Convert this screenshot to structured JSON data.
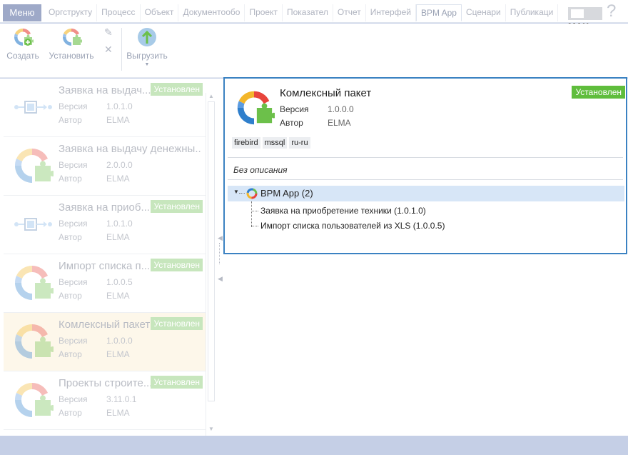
{
  "menubar": {
    "menu_label": "Меню",
    "tabs": [
      "Оргструкту",
      "Процесс",
      "Объект",
      "Документообо",
      "Проект",
      "Показател",
      "Отчет",
      "Интерфей",
      "BPM App",
      "Сценари",
      "Публикаци"
    ],
    "active_tab": "BPM App",
    "max_label": "MAX",
    "help_glyph": "?"
  },
  "toolbar": {
    "create_label": "Создать",
    "install_label": "Установить",
    "export_label": "Выгрузить"
  },
  "list": {
    "items": [
      {
        "title": "Заявка на выдач...",
        "badge": "Установлен",
        "version_label": "Версия",
        "version": "1.0.1.0",
        "author_label": "Автор",
        "author": "ELMA",
        "icon": "process-diagram-icon"
      },
      {
        "title": "Заявка на выдачу денежны...",
        "badge": "",
        "version_label": "Версия",
        "version": "2.0.0.0",
        "author_label": "Автор",
        "author": "ELMA",
        "icon": "bpm-package-icon"
      },
      {
        "title": "Заявка на приоб...",
        "badge": "Установлен",
        "version_label": "Версия",
        "version": "1.0.1.0",
        "author_label": "Автор",
        "author": "ELMA",
        "icon": "process-diagram-icon"
      },
      {
        "title": "Импорт списка п...",
        "badge": "Установлен",
        "version_label": "Версия",
        "version": "1.0.0.5",
        "author_label": "Автор",
        "author": "ELMA",
        "icon": "bpm-package-icon"
      },
      {
        "title": "Комлексный пакет",
        "badge": "Установлен",
        "version_label": "Версия",
        "version": "1.0.0.0",
        "author_label": "Автор",
        "author": "ELMA",
        "icon": "bpm-package-icon"
      },
      {
        "title": "Проекты строите...",
        "badge": "Установлен",
        "version_label": "Версия",
        "version": "3.11.0.1",
        "author_label": "Автор",
        "author": "ELMA",
        "icon": "bpm-package-icon"
      }
    ]
  },
  "detail": {
    "title": "Комлексный пакет",
    "badge": "Установлен",
    "version_label": "Версия",
    "version": "1.0.0.0",
    "author_label": "Автор",
    "author": "ELMA",
    "tags": [
      "firebird",
      "mssql",
      "ru-ru"
    ],
    "description": "Без описания",
    "tree": {
      "root_label": "BPM App (2)",
      "children": [
        "Заявка на приобретение техники (1.0.1.0)",
        "Импорт списка пользователей из XLS (1.0.0.5)"
      ]
    }
  },
  "colors": {
    "accent": "#3b82c2",
    "installed_badge": "#5fbd3c",
    "menu_bg": "#9ea9c8",
    "selected_row": "#fdf7ea"
  }
}
